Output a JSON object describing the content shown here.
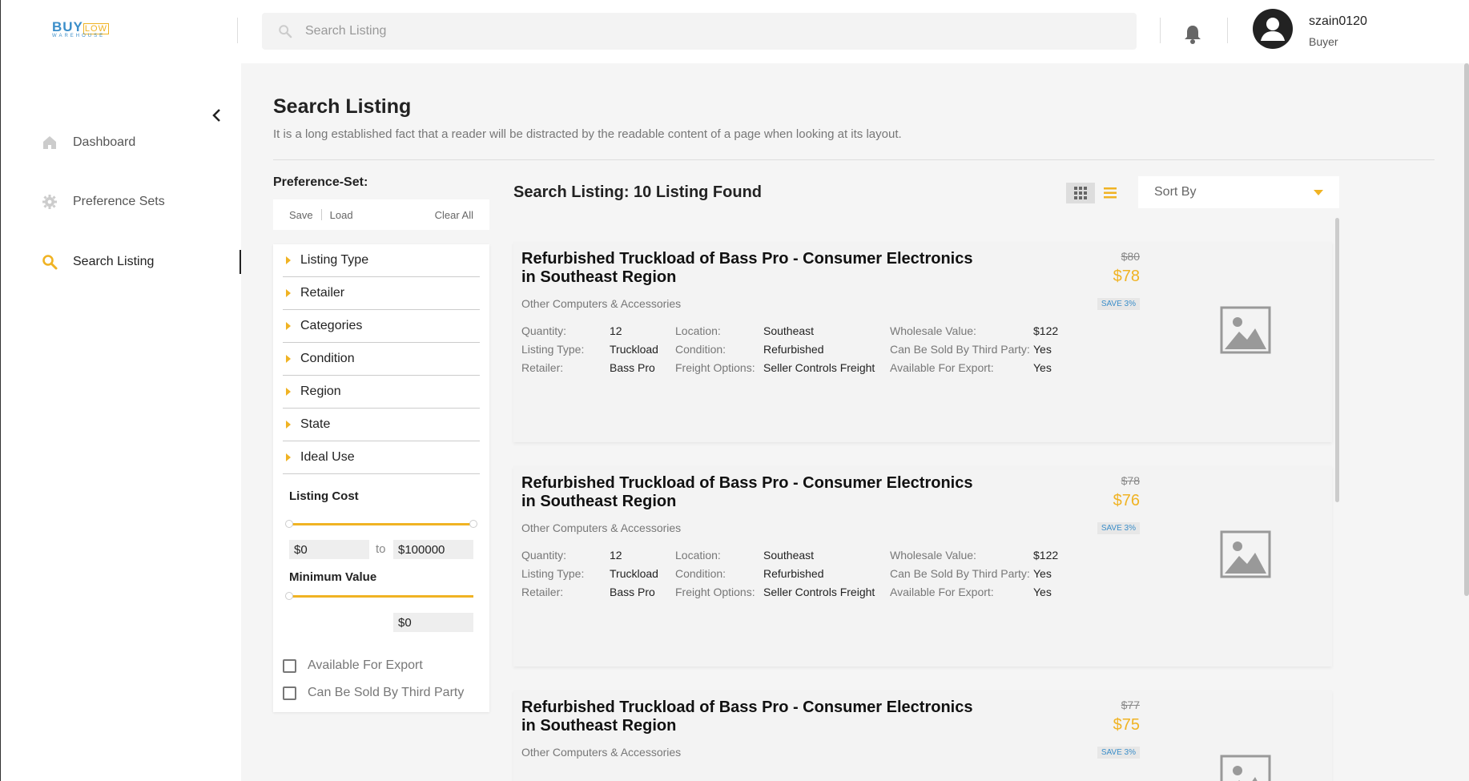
{
  "brand": {
    "buy": "BUY",
    "low": "LOW",
    "warehouse": "WAREHOUSE"
  },
  "sidebar": {
    "items": [
      {
        "label": "Dashboard",
        "icon": "home-icon"
      },
      {
        "label": "Preference Sets",
        "icon": "gear-icon"
      },
      {
        "label": "Search Listing",
        "icon": "search-icon",
        "active": true
      }
    ]
  },
  "header": {
    "search_placeholder": "Search Listing",
    "user": {
      "name": "szain0120",
      "role": "Buyer"
    }
  },
  "page": {
    "title": "Search Listing",
    "subtitle": "It is a long established fact that a reader will be distracted by the readable content of a page when looking at its layout."
  },
  "filters": {
    "preference_title": "Preference-Set:",
    "save": "Save",
    "load": "Load",
    "clear_all": "Clear All",
    "facets": [
      "Listing Type",
      "Retailer",
      "Categories",
      "Condition",
      "Region",
      "State",
      "Ideal Use"
    ],
    "listing_cost": {
      "label": "Listing Cost",
      "min": "$0",
      "to": "to",
      "max": "$100000"
    },
    "minimum_value": {
      "label": "Minimum Value",
      "value": "$0"
    },
    "checkboxes": [
      "Available For Export",
      "Can Be Sold By Third Party"
    ]
  },
  "results": {
    "title": "Search Listing: 10 Listing Found",
    "sort_label": "Sort By",
    "labels": {
      "quantity": "Quantity:",
      "listing_type": "Listing Type:",
      "retailer": "Retailer:",
      "location": "Location:",
      "condition": "Condition:",
      "freight": "Freight Options:",
      "wholesale": "Wholesale Value:",
      "third_party": "Can Be Sold By Third Party:",
      "export": "Available For Export:"
    },
    "listings": [
      {
        "title": "Refurbished Truckload of Bass Pro - Consumer Electronics in Southeast Region",
        "category": "Other Computers & Accessories",
        "old_price": "$80",
        "price": "$78",
        "save": "SAVE 3%",
        "quantity": "12",
        "listing_type": "Truckload",
        "retailer": "Bass Pro",
        "location": "Southeast",
        "condition": "Refurbished",
        "freight": "Seller Controls Freight",
        "wholesale": "$122",
        "third_party": "Yes",
        "export": "Yes"
      },
      {
        "title": "Refurbished Truckload of Bass Pro - Consumer Electronics in Southeast Region",
        "category": "Other Computers & Accessories",
        "old_price": "$78",
        "price": "$76",
        "save": "SAVE 3%",
        "quantity": "12",
        "listing_type": "Truckload",
        "retailer": "Bass Pro",
        "location": "Southeast",
        "condition": "Refurbished",
        "freight": "Seller Controls Freight",
        "wholesale": "$122",
        "third_party": "Yes",
        "export": "Yes"
      },
      {
        "title": "Refurbished Truckload of Bass Pro - Consumer Electronics in Southeast Region",
        "category": "Other Computers & Accessories",
        "old_price": "$77",
        "price": "$75",
        "save": "SAVE 3%",
        "quantity": "",
        "listing_type": "",
        "retailer": "",
        "location": "",
        "condition": "",
        "freight": "",
        "wholesale": "",
        "third_party": "",
        "export": ""
      }
    ]
  },
  "colors": {
    "accent": "#f0b323",
    "brand_blue": "#3b8ec9",
    "main_bg": "#f5f5f5"
  }
}
